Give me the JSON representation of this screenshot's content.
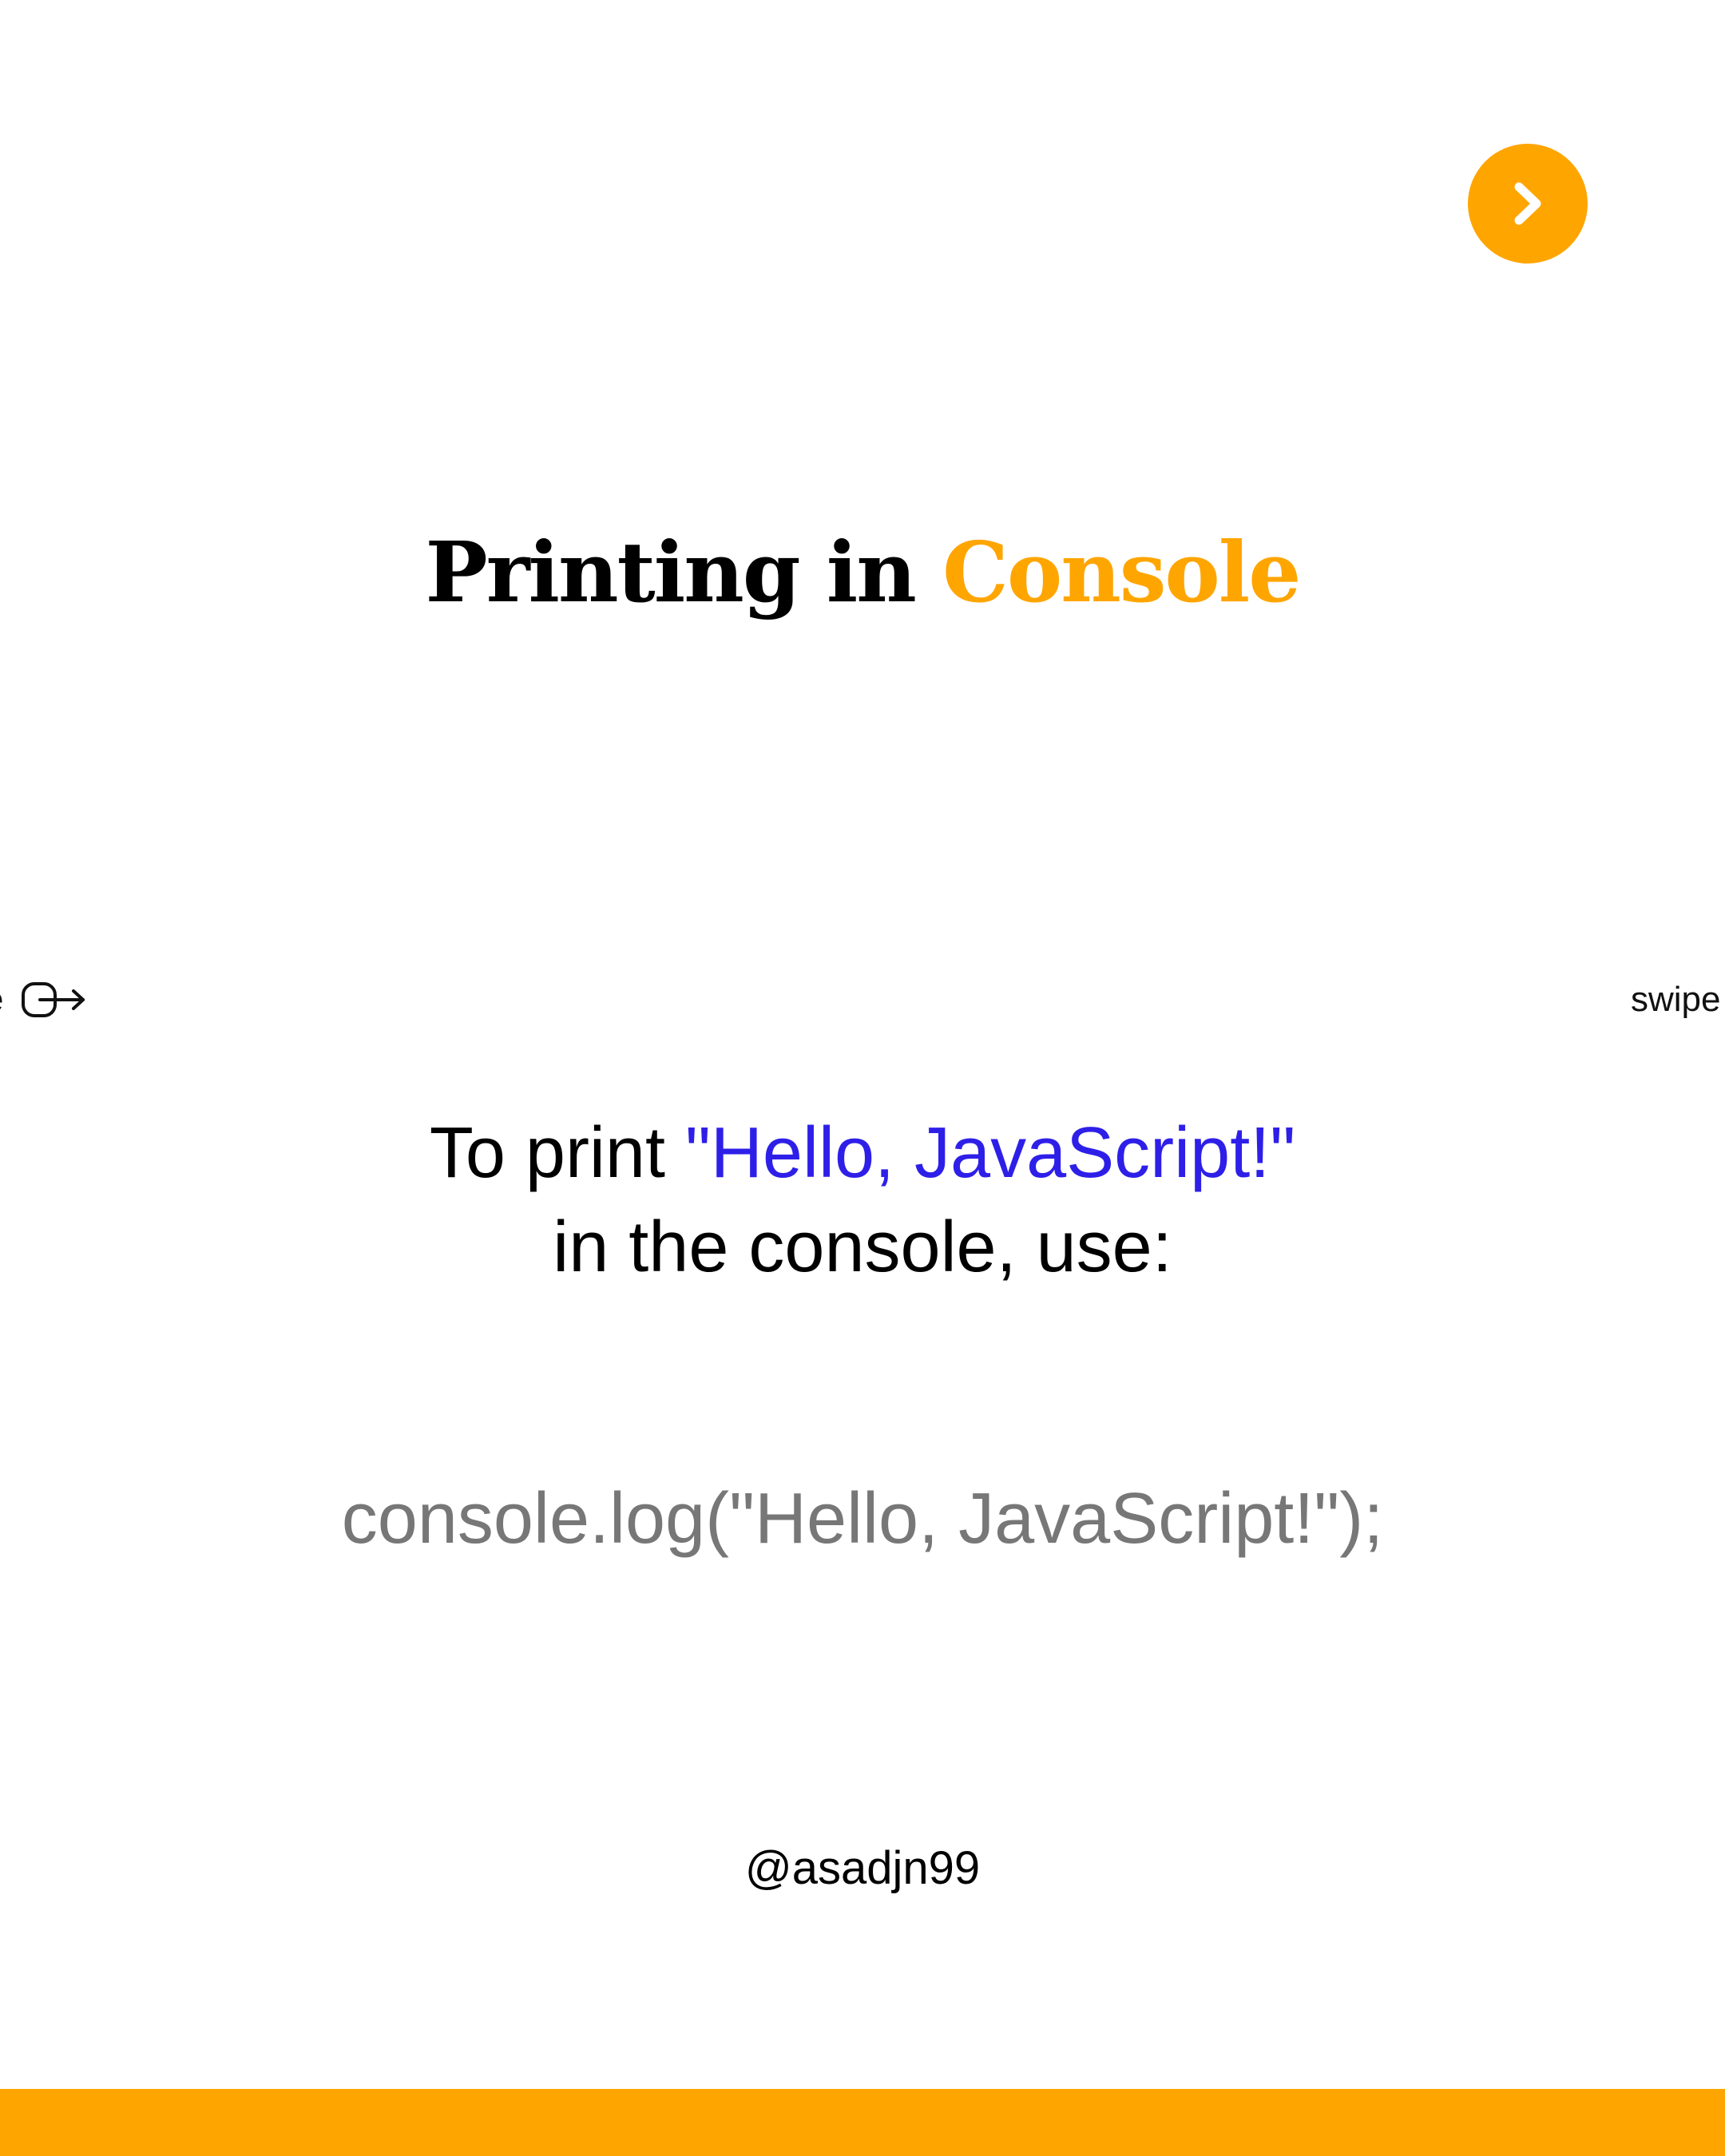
{
  "navigation": {
    "next_icon": "chevron-right-icon",
    "swipe_icon": "swipe-arrow-icon",
    "swipe_label": "swipe",
    "swipe_left_fragment": "e"
  },
  "title": {
    "main": "Printing in",
    "accent": "Console"
  },
  "intro": {
    "prefix": "To print",
    "highlight": "\"Hello, JavaScript!\"",
    "line2": "in the console, use:"
  },
  "code": {
    "line": "console.log(\"Hello, JavaScript!\");"
  },
  "footer": {
    "handle": "@asadjn99"
  },
  "colors": {
    "accent": "#FFA500",
    "highlight": "#2E1FE8",
    "code_text": "#777777",
    "text": "#000000",
    "background": "#FFFFFF"
  }
}
